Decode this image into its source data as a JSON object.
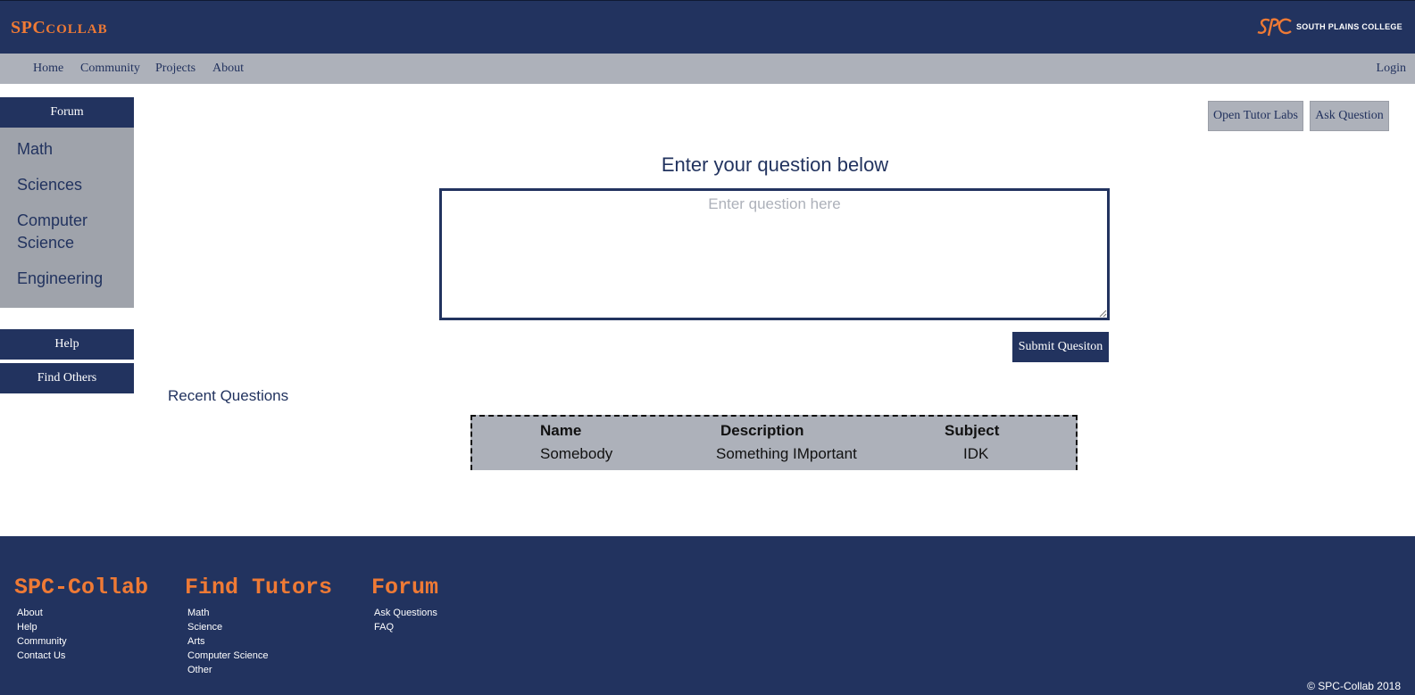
{
  "header": {
    "brand_main": "SPC",
    "brand_small": "COLLAB",
    "college_name": "SOUTH PLAINS COLLEGE",
    "logo_letters": "SPC"
  },
  "nav": {
    "items": [
      "Home",
      "Community",
      "Projects",
      "About"
    ],
    "login": "Login"
  },
  "sidebar": {
    "heading": "Forum",
    "subjects": [
      "Math",
      "Sciences",
      "Computer Science",
      "Engineering"
    ],
    "help": "Help",
    "find_others": "Find Others"
  },
  "actions": {
    "open_tutor_labs": "Open Tutor Labs",
    "ask_question": "Ask Question"
  },
  "question_form": {
    "heading": "Enter your question below",
    "placeholder": "Enter question here",
    "submit": "Submit Quesiton"
  },
  "recent": {
    "title": "Recent Questions",
    "columns": [
      "Name",
      "Description",
      "Subject"
    ],
    "rows": [
      [
        "Somebody",
        "Something IMportant",
        "IDK"
      ]
    ]
  },
  "footer": {
    "columns": [
      {
        "title": "SPC-Collab",
        "links": [
          "About",
          "Help",
          "Community",
          "Contact Us"
        ]
      },
      {
        "title": "Find Tutors",
        "links": [
          "Math",
          "Science",
          "Arts",
          "Computer Science",
          "Other"
        ]
      },
      {
        "title": "Forum",
        "links": [
          "Ask Questions",
          "FAQ"
        ]
      }
    ],
    "copyright": "© SPC-Collab 2018"
  },
  "colors": {
    "navy": "#22335f",
    "orange": "#ef7a35",
    "gray": "#adb1ba",
    "sidebar_gray": "#9fa3ab"
  }
}
